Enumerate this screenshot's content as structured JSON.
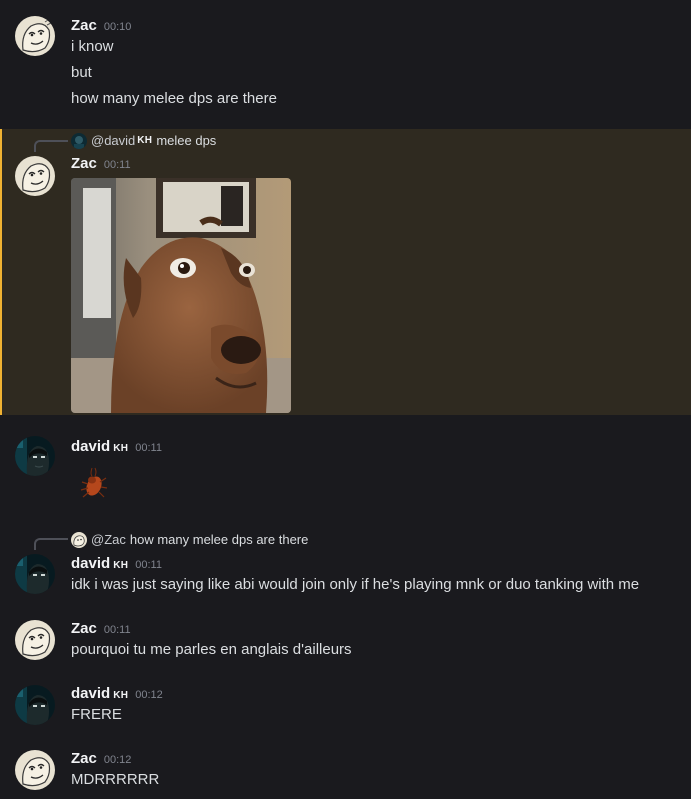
{
  "colors": {
    "background": "#1a1a1e",
    "highlight_background": "#2f2a20",
    "highlight_border": "#f0b232",
    "username": "#f2f3f5",
    "timestamp": "#80848e",
    "message_text": "#dbdee1"
  },
  "groups": [
    {
      "author": "Zac",
      "time": "00:10",
      "messages": [
        "i know",
        "but",
        "how many melee dps are there"
      ]
    },
    {
      "reply": {
        "mention": "@david",
        "tag": "KH",
        "text": "melee dps"
      },
      "author": "Zac",
      "time": "00:11",
      "attachment": "dog-image"
    },
    {
      "author": "david",
      "tag": "KH",
      "time": "00:11",
      "sticker": "cockroach-emoji"
    },
    {
      "reply": {
        "mention": "@Zac",
        "text": "how many melee dps are there"
      },
      "author": "david",
      "tag": "KH",
      "time": "00:11",
      "messages": [
        "idk i was just saying like abi would join only if he's playing mnk or duo tanking with me"
      ]
    },
    {
      "author": "Zac",
      "time": "00:11",
      "messages": [
        "pourquoi tu me parles en anglais d'ailleurs"
      ]
    },
    {
      "author": "david",
      "tag": "KH",
      "time": "00:12",
      "messages": [
        "FRERE"
      ]
    },
    {
      "author": "Zac",
      "time": "00:12",
      "messages": [
        "MDRRRRRR"
      ]
    }
  ]
}
